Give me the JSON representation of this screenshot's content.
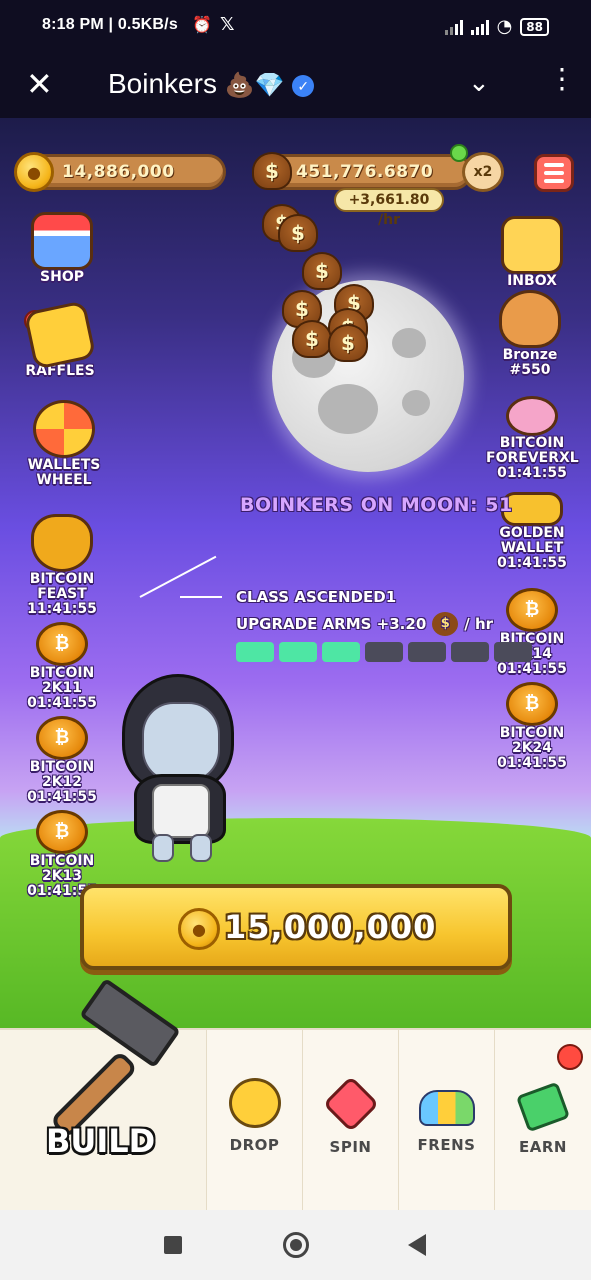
{
  "status_bar": {
    "time_speed": "8:18 PM | 0.5KB/s",
    "x_glyph": "𝕏",
    "alarm_glyph": "⏰",
    "wifi_glyph": "◔",
    "battery": "88"
  },
  "app_header": {
    "close_glyph": "✕",
    "title": "Boinkers",
    "title_emoji": "💩💎",
    "verified_glyph": "✓",
    "dropdown_glyph": "⌄",
    "more_glyph": "⋮"
  },
  "hud": {
    "coin_balance": "14,886,000",
    "poop_balance": "451,776.6870",
    "poop_rate": "+3,661.80 /hr",
    "boost_label": "x2",
    "coin_symbol": "●",
    "dollar_symbol": "$"
  },
  "left_buttons": [
    {
      "label": "SHOP",
      "timer": ""
    },
    {
      "label": "RAFFLES",
      "timer": ""
    },
    {
      "label": "WALLETS WHEEL",
      "timer": ""
    },
    {
      "label": "BITCOIN FEAST",
      "timer": "11:41:55"
    },
    {
      "label": "BITCOIN 2K11",
      "timer": "01:41:55"
    },
    {
      "label": "BITCOIN 2K12",
      "timer": "01:41:55"
    },
    {
      "label": "BITCOIN 2K13",
      "timer": "01:41:55"
    }
  ],
  "right_buttons": [
    {
      "label": "INBOX",
      "timer": ""
    },
    {
      "label": "Bronze",
      "timer": "#550"
    },
    {
      "label": "BITCOIN FOREVERXL",
      "timer": "01:41:55"
    },
    {
      "label": "GOLDEN WALLET",
      "timer": "01:41:55"
    },
    {
      "label": "BITCOIN 2K14",
      "timer": "01:41:55"
    },
    {
      "label": "BITCOIN 2K24",
      "timer": "01:41:55"
    }
  ],
  "moon": {
    "boinkers_on_moon": "BOINKERS ON MOON: 51"
  },
  "upgrade": {
    "class_text": "CLASS ASCENDED1",
    "upgrade_text": "UPGRADE ARMS +3.20",
    "rate_suffix": "/ hr",
    "progress_filled": 3,
    "progress_total": 7
  },
  "build_price": {
    "amount": "15,000,000"
  },
  "bottom_nav": {
    "build": "BUILD",
    "items": [
      {
        "label": "DROP"
      },
      {
        "label": "SPIN"
      },
      {
        "label": "FRENS"
      },
      {
        "label": "EARN"
      }
    ]
  },
  "colors": {
    "progress_on": "#4ee6a4",
    "progress_off": "#4b4b5a",
    "accent_yellow": "#f7c52e",
    "notification_red": "#ff4b40"
  }
}
